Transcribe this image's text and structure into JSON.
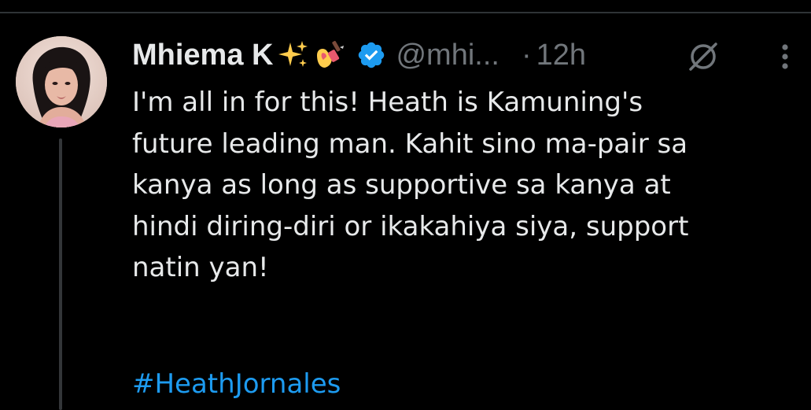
{
  "tweet": {
    "author": {
      "display_name": "Mhiema K",
      "name_emojis": [
        "sparkles-emoji",
        "nail-polish-emoji"
      ],
      "verified": true,
      "handle": "@mhi...",
      "avatar": "profile-photo"
    },
    "timestamp_separator": "·",
    "timestamp": "12h",
    "text_lines": [
      "I'm all in for this! Heath is Kamuning's",
      "future leading man. Kahit sino ma-pair sa",
      "kanya as long as supportive sa kanya at",
      "hindi diring-diri or ikakahiya siya, support",
      "natin yan!"
    ],
    "hashtag": "#HeathJornales"
  },
  "icons": {
    "verified": "verified-badge-icon",
    "grok": "grok-icon",
    "more": "more-options-icon"
  },
  "colors": {
    "background": "#000000",
    "text": "#e7e9ea",
    "secondary_text": "#71767b",
    "link": "#1d9bf0",
    "verified_badge": "#1d9bf0",
    "divider": "#2f3336",
    "thread_line": "#333639"
  }
}
